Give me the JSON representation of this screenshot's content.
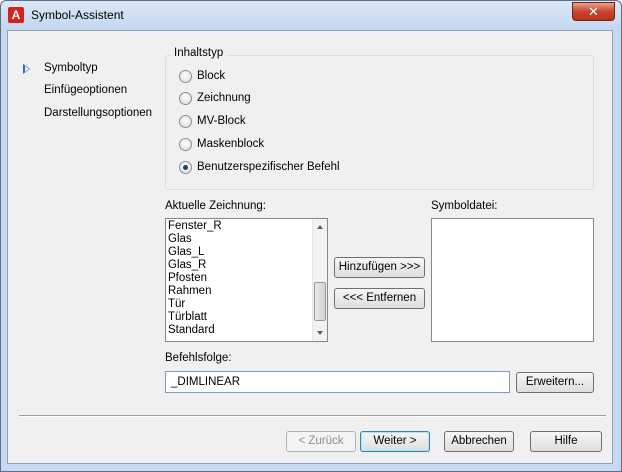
{
  "window": {
    "title": "Symbol-Assistent",
    "close_glyph": "✕",
    "app_icon": "autocad-icon"
  },
  "nav": {
    "items": [
      {
        "label": "Symboltyp",
        "active": true
      },
      {
        "label": "Einfügeoptionen",
        "active": false
      },
      {
        "label": "Darstellungsoptionen",
        "active": false
      }
    ]
  },
  "content_type": {
    "title": "Inhaltstyp",
    "options": [
      {
        "label": "Block",
        "checked": false
      },
      {
        "label": "Zeichnung",
        "checked": false
      },
      {
        "label": "MV-Block",
        "checked": false
      },
      {
        "label": "Maskenblock",
        "checked": false
      },
      {
        "label": "Benutzerspezifischer Befehl",
        "checked": true
      }
    ]
  },
  "current_drawing": {
    "label": "Aktuelle Zeichnung:",
    "items": [
      "Fenster_R",
      "Glas",
      "Glas_L",
      "Glas_R",
      "Pfosten",
      "Rahmen",
      "Tür",
      "Türblatt",
      "Standard"
    ]
  },
  "symbol_file": {
    "label": "Symboldatei:",
    "items": []
  },
  "transfer": {
    "add_label": "Hinzufügen >>>",
    "remove_label": "<<< Entfernen"
  },
  "command": {
    "label": "Befehlsfolge:",
    "value": "_DIMLINEAR",
    "expand_label": "Erweitern..."
  },
  "footer": {
    "back_label": "< Zurück",
    "next_label": "Weiter >",
    "cancel_label": "Abbrechen",
    "help_label": "Hilfe"
  }
}
